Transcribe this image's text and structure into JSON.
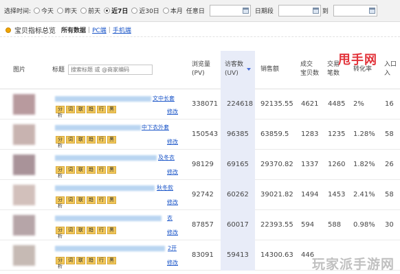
{
  "filter": {
    "label": "选择时间:",
    "options": [
      {
        "label": "今天",
        "checked": false
      },
      {
        "label": "昨天",
        "checked": false
      },
      {
        "label": "前天",
        "checked": false
      },
      {
        "label": "近7日",
        "checked": true
      },
      {
        "label": "近30日",
        "checked": false
      },
      {
        "label": "本月",
        "checked": false
      }
    ],
    "custom_label": "任意日",
    "range_label": "日期段",
    "to_label": "到"
  },
  "section": {
    "title": "宝贝指标总览",
    "tabs": [
      "所有数据",
      "PC端",
      "手机端"
    ],
    "separator": "|"
  },
  "columns": {
    "picture": "图片",
    "title": "标题",
    "search_placeholder": "搜索标题 或 @商家编码",
    "pv_line1": "浏览量",
    "pv_line2": "(PV)",
    "uv_line1": "访客数",
    "uv_line2": "(UV)",
    "sales": "销售额",
    "deal_items_line1": "成交",
    "deal_items_line2": "宝贝数",
    "deal_orders_line1": "交易",
    "deal_orders_line2": "笔数",
    "conversion": "转化率",
    "last_line1": "入口",
    "last_line2": "入"
  },
  "tool_labels": [
    "分析",
    "词",
    "联",
    "趋",
    "行",
    "黑"
  ],
  "edit_label": "修改",
  "rows": [
    {
      "snippet": "文中长套",
      "pv": "338071",
      "uv": "224618",
      "sales": "92135.55",
      "deal_items": "4621",
      "deal_orders": "4485",
      "conversion": "2%",
      "last": "16"
    },
    {
      "snippet": "中下衣外套",
      "pv": "150543",
      "uv": "96385",
      "sales": "63859.5",
      "deal_items": "1283",
      "deal_orders": "1235",
      "conversion": "1.28%",
      "last": "58"
    },
    {
      "snippet": "及冬衣",
      "pv": "98129",
      "uv": "69165",
      "sales": "29370.82",
      "deal_items": "1337",
      "deal_orders": "1260",
      "conversion": "1.82%",
      "last": "26"
    },
    {
      "snippet": "秋冬款",
      "pv": "92742",
      "uv": "60262",
      "sales": "39021.82",
      "deal_items": "1494",
      "deal_orders": "1453",
      "conversion": "2.41%",
      "last": "58"
    },
    {
      "snippet": "衣",
      "pv": "87857",
      "uv": "60017",
      "sales": "22393.55",
      "deal_items": "594",
      "deal_orders": "588",
      "conversion": "0.98%",
      "last": "30"
    },
    {
      "snippet": "2开",
      "pv": "83091",
      "uv": "59413",
      "sales": "14300.63",
      "deal_items": "446",
      "deal_orders": "",
      "conversion": "",
      "last": ""
    }
  ],
  "watermarks": {
    "top": "甩手网",
    "bottom": "玩家派手游网"
  }
}
